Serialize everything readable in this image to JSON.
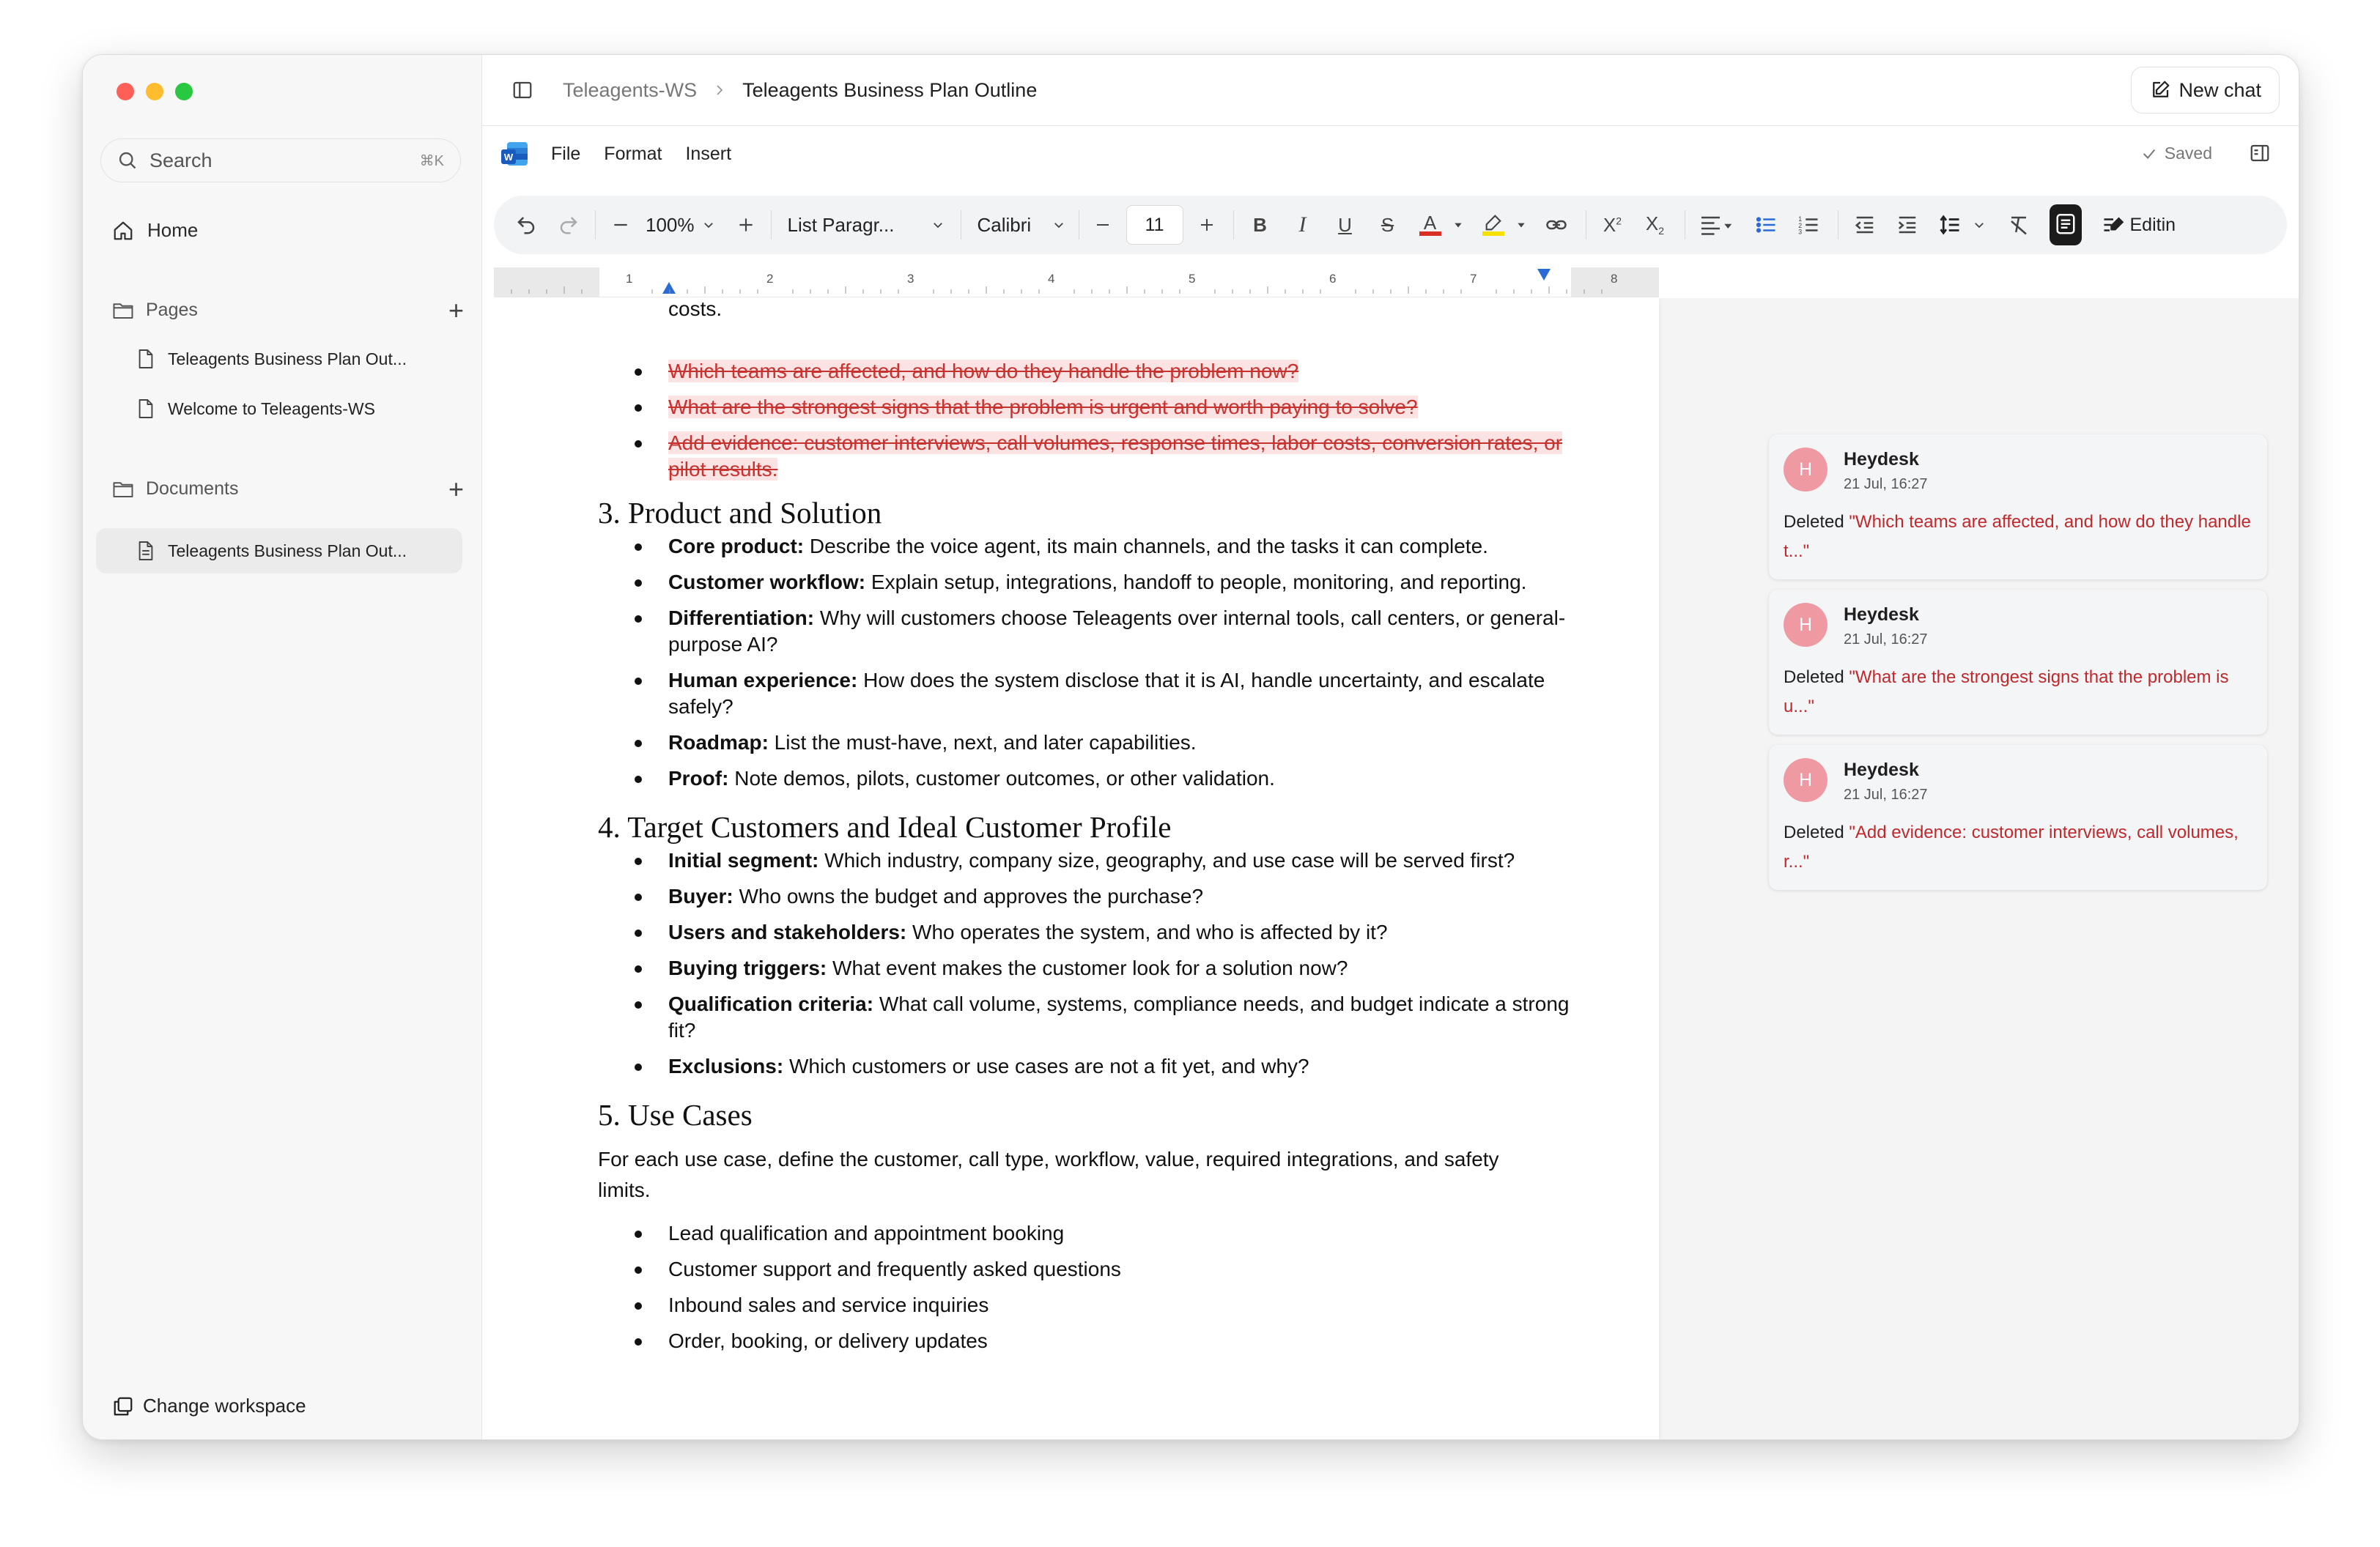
{
  "sidebar": {
    "search_label": "Search",
    "search_shortcut": "⌘K",
    "home_label": "Home",
    "pages_label": "Pages",
    "pages": [
      {
        "label": "Teleagents Business Plan Out..."
      },
      {
        "label": "Welcome to Teleagents-WS"
      }
    ],
    "documents_label": "Documents",
    "documents": [
      {
        "label": "Teleagents Business Plan Out..."
      }
    ],
    "change_workspace_label": "Change workspace"
  },
  "topbar": {
    "workspace": "Teleagents-WS",
    "separator": ">",
    "document_title": "Teleagents Business Plan Outline",
    "new_chat_label": "New chat"
  },
  "menubar": {
    "items": [
      "File",
      "Format",
      "Insert"
    ],
    "status": "Saved"
  },
  "toolbar": {
    "zoom": "100%",
    "style": "List Paragr...",
    "font": "Calibri",
    "font_size": "11",
    "editing_label": "Editin",
    "font_color": "#d93025",
    "highlight_color": "#f5e000"
  },
  "ruler": {
    "numbers": [
      "1",
      "2",
      "3",
      "4",
      "5",
      "6",
      "7",
      "8"
    ]
  },
  "document": {
    "top_fragment": "costs.",
    "deleted_items": [
      "Which teams are affected, and how do they handle the problem now?",
      "What are the strongest signs that the problem is urgent and worth paying to solve?",
      "Add evidence: customer interviews, call volumes, response times, labor costs, conversion rates, or pilot results."
    ],
    "section3": {
      "heading": "3. Product and Solution",
      "items": [
        {
          "term": "Core product:",
          "text": " Describe the voice agent, its main channels, and the tasks it can complete."
        },
        {
          "term": "Customer workflow:",
          "text": " Explain setup, integrations, handoff to people, monitoring, and reporting."
        },
        {
          "term": "Differentiation:",
          "text": " Why will customers choose Teleagents over internal tools, call centers, or general-purpose AI?"
        },
        {
          "term": "Human experience:",
          "text": " How does the system disclose that it is AI, handle uncertainty, and escalate safely?"
        },
        {
          "term": "Roadmap:",
          "text": " List the must-have, next, and later capabilities."
        },
        {
          "term": "Proof:",
          "text": " Note demos, pilots, customer outcomes, or other validation."
        }
      ]
    },
    "section4": {
      "heading": "4. Target Customers and Ideal Customer Profile",
      "items": [
        {
          "term": "Initial segment:",
          "text": " Which industry, company size, geography, and use case will be served first?"
        },
        {
          "term": "Buyer:",
          "text": " Who owns the budget and approves the purchase?"
        },
        {
          "term": "Users and stakeholders:",
          "text": " Who operates the system, and who is affected by it?"
        },
        {
          "term": "Buying triggers:",
          "text": " What event makes the customer look for a solution now?"
        },
        {
          "term": "Qualification criteria:",
          "text": " What call volume, systems, compliance needs, and budget indicate a strong fit?"
        },
        {
          "term": "Exclusions:",
          "text": " Which customers or use cases are not a fit yet, and why?"
        }
      ]
    },
    "section5": {
      "heading": "5. Use Cases",
      "intro": "For each use case, define the customer, call type, workflow, value, required integrations, and safety limits.",
      "items": [
        "Lead qualification and appointment booking",
        "Customer support and frequently asked questions",
        "Inbound sales and service inquiries",
        "Order, booking, or delivery updates"
      ]
    }
  },
  "comments": [
    {
      "initial": "H",
      "author": "Heydesk",
      "time": "21 Jul, 16:27",
      "action": "Deleted ",
      "quote": "\"Which teams are affected, and how do they handle t...\""
    },
    {
      "initial": "H",
      "author": "Heydesk",
      "time": "21 Jul, 16:27",
      "action": "Deleted ",
      "quote": "\"What are the strongest signs that the problem is u...\""
    },
    {
      "initial": "H",
      "author": "Heydesk",
      "time": "21 Jul, 16:27",
      "action": "Deleted ",
      "quote": "\"Add evidence: customer interviews, call volumes, r...\""
    }
  ]
}
